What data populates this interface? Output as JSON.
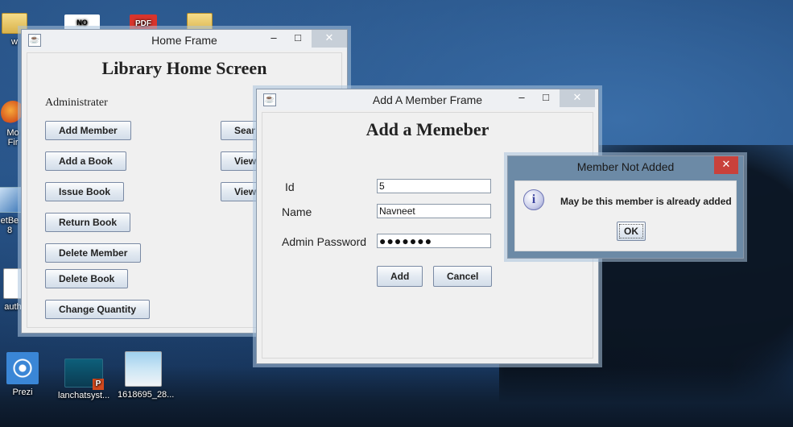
{
  "desktop": {
    "icons": [
      {
        "label": "w",
        "name": "folder"
      },
      {
        "label": "NO SHAVE",
        "name": "noshave"
      },
      {
        "label": "PDF",
        "name": "pdf"
      },
      {
        "label": "",
        "name": "folder2"
      },
      {
        "label": "Mo\nFir",
        "name": "firefox"
      },
      {
        "label": "etBe\n8",
        "name": "netbeans"
      },
      {
        "label": "auth",
        "name": "doc"
      },
      {
        "label": "Prezi",
        "name": "prezi"
      },
      {
        "label": "lanchatsyst...",
        "name": "ppt"
      },
      {
        "label": "1618695_28...",
        "name": "image"
      }
    ]
  },
  "home_frame": {
    "title": "Home Frame",
    "heading": "Library Home Screen",
    "role_label": "Administrater",
    "left_buttons": [
      "Add Member",
      "Add a Book",
      "Issue Book",
      "Return Book",
      "Delete Member",
      "Delete Book",
      "Change Quantity"
    ],
    "right_buttons": [
      "Sear",
      "View",
      "View"
    ],
    "minimize": "–",
    "maximize": "□",
    "close": "✕"
  },
  "add_member_frame": {
    "title": "Add A Member Frame",
    "heading": "Add a Memeber",
    "fields": [
      {
        "label": "Id",
        "value": "5"
      },
      {
        "label": "Name",
        "value": "Navneet"
      },
      {
        "label": "Admin Password",
        "value": "●●●●●●●"
      }
    ],
    "add_label": "Add",
    "cancel_label": "Cancel",
    "minimize": "–",
    "maximize": "□",
    "close": "✕"
  },
  "dialog": {
    "title": "Member Not Added",
    "message": "May be this member is already added",
    "ok_label": "OK",
    "info_glyph": "i",
    "close": "✕"
  }
}
